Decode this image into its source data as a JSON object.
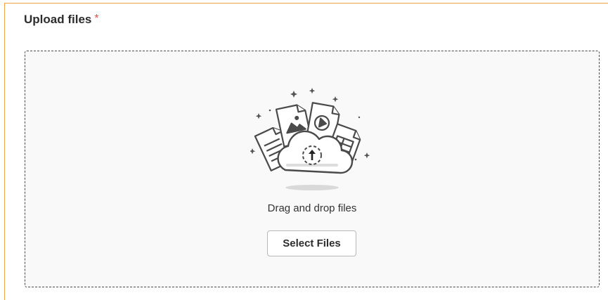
{
  "section": {
    "title": "Upload files",
    "required_marker": "*"
  },
  "dropzone": {
    "icon": "cloud-upload-files-icon",
    "instruction": "Drag and drop files",
    "button_label": "Select Files"
  },
  "colors": {
    "accent_border": "#f0a347",
    "required": "#d9534f",
    "dropzone_bg": "#f9f9f9"
  }
}
